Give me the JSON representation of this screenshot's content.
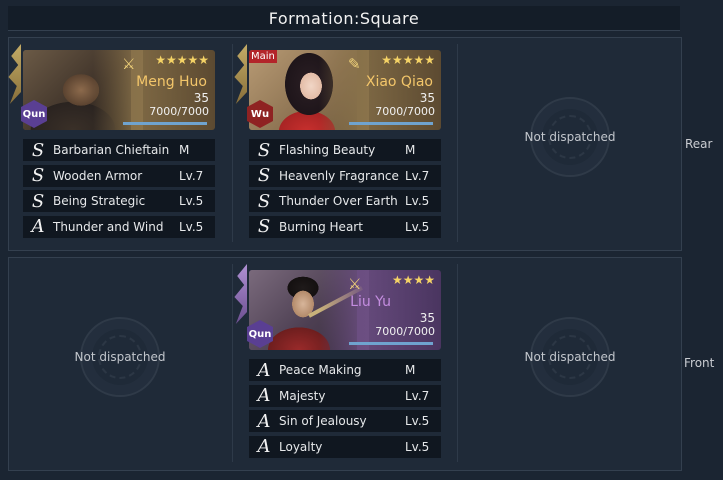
{
  "formation_title": "Formation:Square",
  "rows": {
    "rear_label": "Rear",
    "front_label": "Front"
  },
  "empty_text": "Not dispatched",
  "generals": {
    "meng_huo": {
      "name": "Meng Huo",
      "stars": "★★★★★",
      "level": "35",
      "troops": "7000/7000",
      "troop_ratio": 1.0,
      "faction": "Qun",
      "rank_icon": "crossed-axes-icon",
      "skills": [
        {
          "grade": "S",
          "name": "Barbarian Chieftain",
          "level": "M"
        },
        {
          "grade": "S",
          "name": "Wooden Armor",
          "level": "Lv.7"
        },
        {
          "grade": "S",
          "name": "Being Strategic",
          "level": "Lv.5"
        },
        {
          "grade": "A",
          "name": "Thunder and Wind",
          "level": "Lv.5"
        }
      ]
    },
    "xiao_qiao": {
      "name": "Xiao Qiao",
      "stars": "★★★★★",
      "level": "35",
      "troops": "7000/7000",
      "troop_ratio": 1.0,
      "faction": "Wu",
      "main_tag": "Main",
      "rank_icon": "fan-icon",
      "skills": [
        {
          "grade": "S",
          "name": "Flashing Beauty",
          "level": "M"
        },
        {
          "grade": "S",
          "name": "Heavenly Fragrance",
          "level": "Lv.7"
        },
        {
          "grade": "S",
          "name": "Thunder Over Earth",
          "level": "Lv.5"
        },
        {
          "grade": "S",
          "name": "Burning Heart",
          "level": "Lv.5"
        }
      ]
    },
    "liu_yu": {
      "name": "Liu Yu",
      "stars": "★★★★",
      "level": "35",
      "troops": "7000/7000",
      "troop_ratio": 1.0,
      "faction": "Qun",
      "rank_icon": "crossed-axes-icon",
      "skills": [
        {
          "grade": "A",
          "name": "Peace Making",
          "level": "M"
        },
        {
          "grade": "A",
          "name": "Majesty",
          "level": "Lv.7"
        },
        {
          "grade": "A",
          "name": "Sin of Jealousy",
          "level": "Lv.5"
        },
        {
          "grade": "A",
          "name": "Loyalty",
          "level": "Lv.5"
        }
      ]
    }
  },
  "colors": {
    "gold_name": "#f3c66a",
    "purple_name": "#c48de0",
    "qun_badge": "#5a3f93",
    "wu_badge": "#8f2222",
    "star": "#f5d366"
  }
}
